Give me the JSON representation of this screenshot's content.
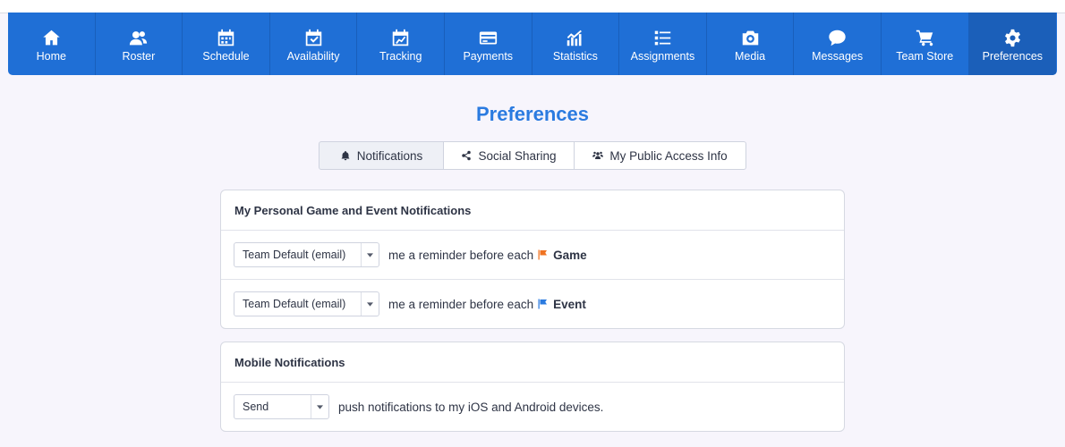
{
  "nav": {
    "items": [
      {
        "label": "Home",
        "icon": "home-icon"
      },
      {
        "label": "Roster",
        "icon": "users-icon"
      },
      {
        "label": "Schedule",
        "icon": "calendar-icon"
      },
      {
        "label": "Availability",
        "icon": "calendar-check-icon"
      },
      {
        "label": "Tracking",
        "icon": "tracking-chart-icon"
      },
      {
        "label": "Payments",
        "icon": "credit-card-icon"
      },
      {
        "label": "Statistics",
        "icon": "bar-chart-icon"
      },
      {
        "label": "Assignments",
        "icon": "list-icon"
      },
      {
        "label": "Media",
        "icon": "camera-icon"
      },
      {
        "label": "Messages",
        "icon": "chat-bubble-icon"
      },
      {
        "label": "Team Store",
        "icon": "shopping-cart-icon"
      },
      {
        "label": "Preferences",
        "icon": "gear-icon"
      }
    ],
    "active": "Preferences",
    "color": "#1f6fd6"
  },
  "page": {
    "title": "Preferences"
  },
  "tabs": [
    {
      "label": "Notifications",
      "icon": "bell-icon"
    },
    {
      "label": "Social Sharing",
      "icon": "share-icon"
    },
    {
      "label": "My Public Access Info",
      "icon": "group-icon"
    }
  ],
  "personal": {
    "heading": "My Personal Game and Event Notifications",
    "rows": [
      {
        "select": "Team Default (email)",
        "text": "me a reminder before each",
        "kind": "Game",
        "flag_color": "#f07322"
      },
      {
        "select": "Team Default (email)",
        "text": "me a reminder before each",
        "kind": "Event",
        "flag_color": "#2b7be0"
      }
    ]
  },
  "mobile": {
    "heading": "Mobile Notifications",
    "row": {
      "select": "Send",
      "text": "push notifications to my iOS and Android devices."
    }
  }
}
